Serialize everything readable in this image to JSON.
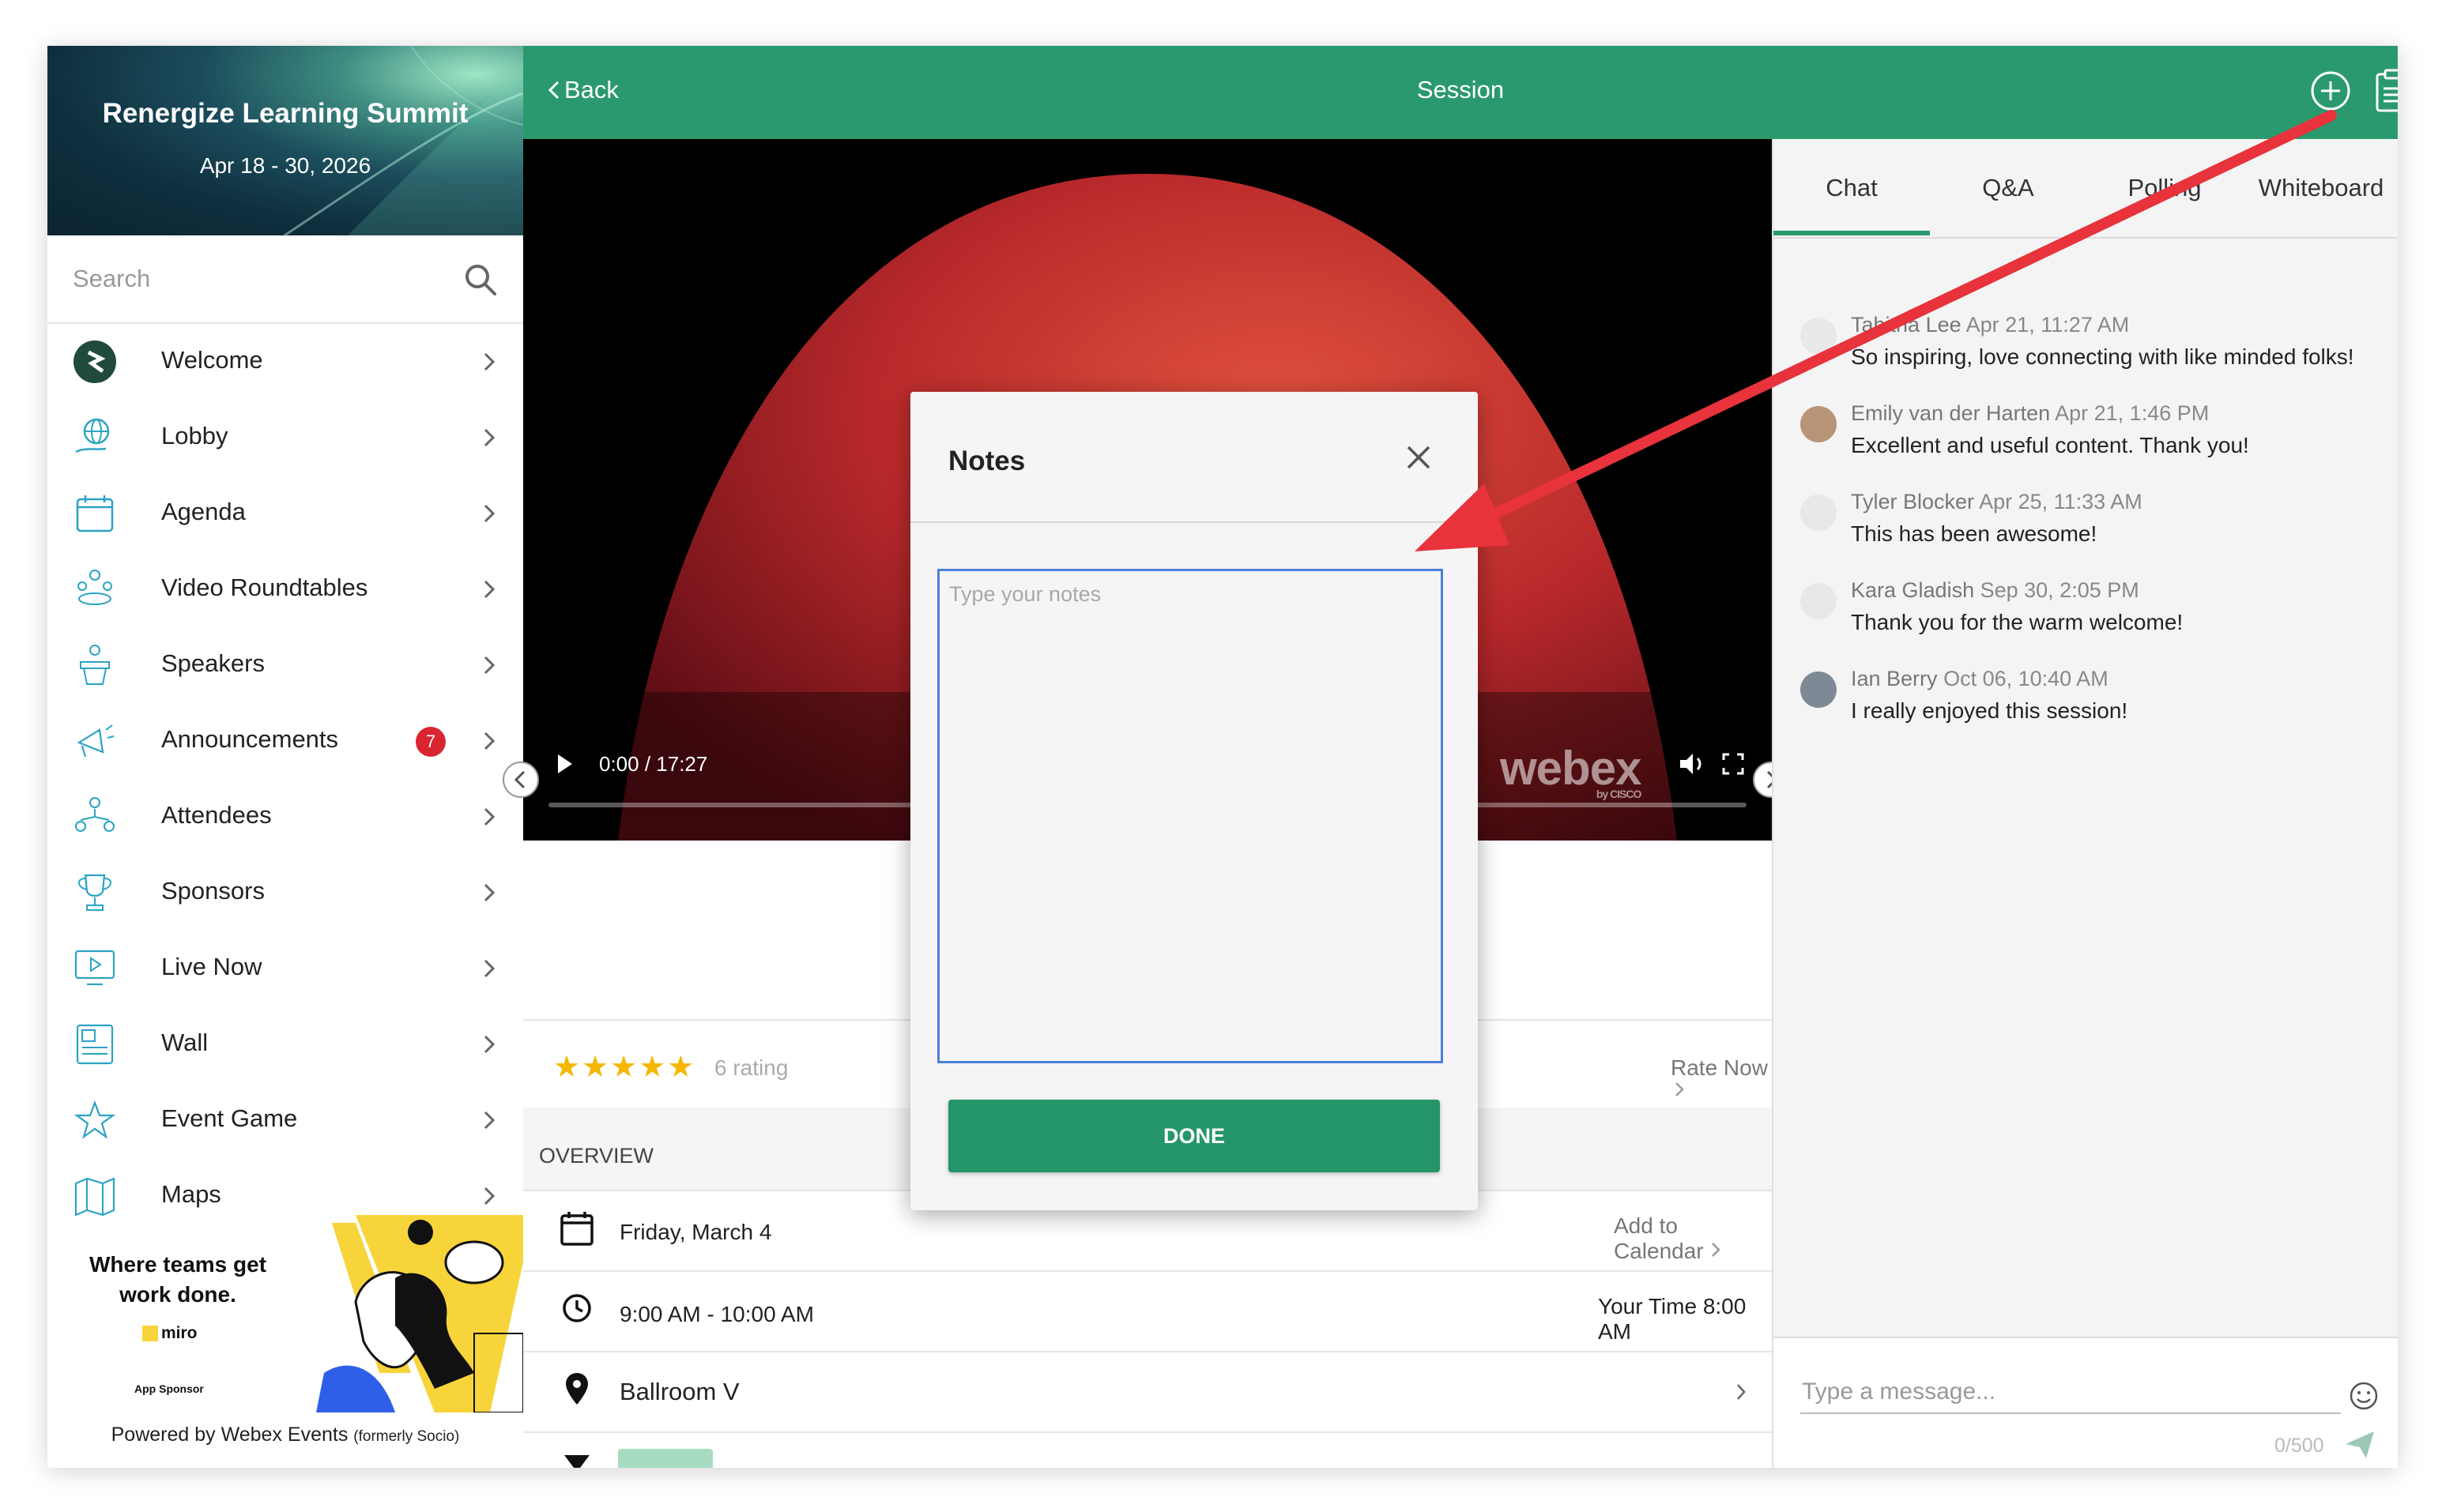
{
  "event": {
    "title": "Renergize Learning Summit",
    "dates": "Apr 18 - 30, 2026"
  },
  "search": {
    "placeholder": "Search"
  },
  "sidebar": {
    "items": [
      {
        "label": "Welcome",
        "icon": "welcome-logo-icon"
      },
      {
        "label": "Lobby",
        "icon": "globe-hand-icon"
      },
      {
        "label": "Agenda",
        "icon": "calendar-icon"
      },
      {
        "label": "Video Roundtables",
        "icon": "roundtable-icon"
      },
      {
        "label": "Speakers",
        "icon": "podium-icon"
      },
      {
        "label": "Announcements",
        "icon": "megaphone-icon",
        "badge": "7"
      },
      {
        "label": "Attendees",
        "icon": "people-network-icon"
      },
      {
        "label": "Sponsors",
        "icon": "trophy-icon"
      },
      {
        "label": "Live Now",
        "icon": "monitor-play-icon"
      },
      {
        "label": "Wall",
        "icon": "wall-posts-icon"
      },
      {
        "label": "Event Game",
        "icon": "star-icon"
      },
      {
        "label": "Maps",
        "icon": "map-icon"
      }
    ],
    "sponsor": {
      "tagline_1": "Where teams get",
      "tagline_2": "work done.",
      "brand": "miro",
      "caption": "App Sponsor"
    },
    "powered_by": "Powered by Webex Events",
    "powered_by_note": "(formerly Socio)"
  },
  "header": {
    "back_label": "Back",
    "title": "Session"
  },
  "video": {
    "time": "0:00 / 17:27",
    "watermark": "webex",
    "watermark_sub": "by CISCO",
    "progress": 0
  },
  "rating": {
    "stars": 5,
    "count_label": "6 rating",
    "rate_now_label": "Rate Now"
  },
  "overview": {
    "header": "OVERVIEW",
    "date": "Friday, March 4",
    "add_to_calendar": "Add to Calendar",
    "time": "9:00 AM - 10:00 AM",
    "your_time_label": "Your Time",
    "your_time_value": "8:00 AM",
    "location": "Ballroom V"
  },
  "panel": {
    "tabs": [
      "Chat",
      "Q&A",
      "Polling",
      "Whiteboard"
    ],
    "active_tab": "Chat",
    "messages": [
      {
        "name": "Tabitha Lee",
        "date": "Apr 21, 11:27 AM",
        "text": "So inspiring, love connecting with like minded folks!"
      },
      {
        "name": "Emily van der Harten",
        "date": "Apr 21, 1:46 PM",
        "text": "Excellent and useful content. Thank you!"
      },
      {
        "name": "Tyler Blocker",
        "date": "Apr 25, 11:33 AM",
        "text": "This has been awesome!"
      },
      {
        "name": "Kara Gladish",
        "date": "Sep 30, 2:05 PM",
        "text": "Thank you for the warm welcome!"
      },
      {
        "name": "Ian Berry",
        "date": "Oct 06, 10:40 AM",
        "text": "I really enjoyed this session!"
      }
    ],
    "composer_placeholder": "Type a message...",
    "char_count": "0/500"
  },
  "modal": {
    "title": "Notes",
    "notes_placeholder": "Type your notes",
    "done_label": "DONE"
  },
  "colors": {
    "brand_green": "#2a9a6e",
    "badge_red": "#d9252f",
    "annotation_arrow": "#e8323c",
    "focus_blue": "#4a7fd9"
  }
}
